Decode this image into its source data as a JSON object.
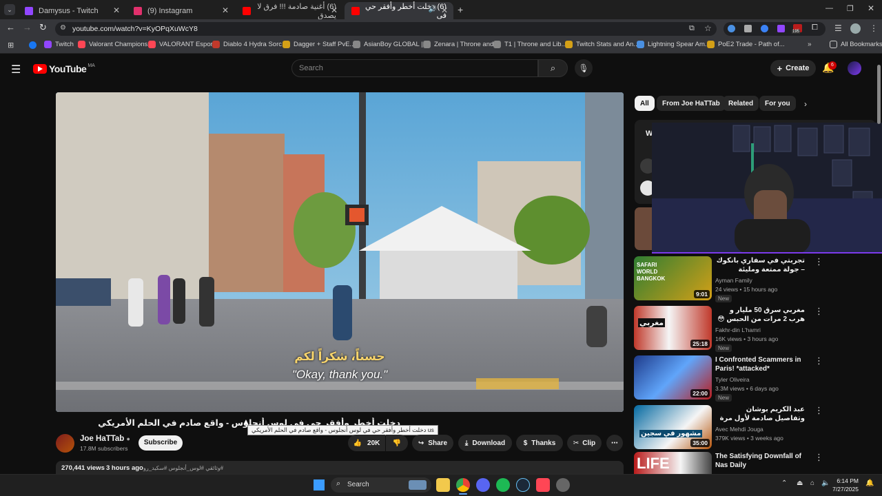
{
  "browser": {
    "tabs": [
      {
        "title": "Damysus - Twitch",
        "color": "#9146ff"
      },
      {
        "title": "(9) Instagram",
        "color": "#e1306c"
      },
      {
        "title": "(6) أغنية صادمة !!! فرق لا يصدق",
        "color": "#ff0000"
      },
      {
        "title": "(6) دخلت أخطر وأفقر حي في",
        "color": "#ff0000"
      }
    ],
    "url": "youtube.com/watch?v=KyOPqXuWcY8",
    "extension_badge": "195",
    "all_bookmarks_label": "All Bookmarks",
    "bookmarks": [
      {
        "label": "Twitch",
        "color": "#9146ff"
      },
      {
        "label": "Valorant Champions...",
        "color": "#ff4655"
      },
      {
        "label": "VALORANT Esports",
        "color": "#ff4655"
      },
      {
        "label": "Diablo 4 Hydra Sorc...",
        "color": "#c0392b"
      },
      {
        "label": "Dagger + Staff PvE...",
        "color": "#d4a017"
      },
      {
        "label": "AsianBoy GLOBAL |...",
        "color": "#888888"
      },
      {
        "label": "Zenara | Throne and...",
        "color": "#888888"
      },
      {
        "label": "T1 | Throne and Lib...",
        "color": "#888888"
      },
      {
        "label": "Twitch Stats and An...",
        "color": "#d4a017"
      },
      {
        "label": "Lightning Spear Am...",
        "color": "#4a90e2"
      },
      {
        "label": "PoE2 Trade - Path of...",
        "color": "#d4a017"
      }
    ]
  },
  "youtube": {
    "logo_text": "YouTube",
    "region": "MA",
    "search_placeholder": "Search",
    "create_label": "Create",
    "notification_count": "6",
    "chips": [
      "All",
      "From Joe HaTTab",
      "Related",
      "For you"
    ],
    "video": {
      "subtitle_arabic": "حسناً، شكراً لكم",
      "subtitle_english": "\"Okay, thank you.\"",
      "title": "دخلت أخطر وأفقر حي في لوس أنجلوس - واقع صادم في الحلم الأمريكي",
      "tooltip": "us دخلت أخطر وأفقر حي في لوس أنجلوس - واقع صادم في الحلم الأمريكي",
      "channel": "Joe HaTTab",
      "subscribers": "17.8M subscribers",
      "subscribe_label": "Subscribe",
      "likes": "20K",
      "share_label": "Share",
      "download_label": "Download",
      "thanks_label": "Thanks",
      "clip_label": "Clip",
      "views": "270,441 views",
      "age": "3 hours ago",
      "hashtags": "#وثائقي #لوس_أنجلوس #سكيد_رو"
    },
    "recommendations": [
      {
        "title": "تجربتي في سفاري بانكوك – جولة ممتعة ومليئة بالمرح 🌿 My Visit to Saf...",
        "channel": "Ayman Family",
        "meta": "24 views • 15 hours ago",
        "badge": "New",
        "duration": "9:01",
        "thumb_text": "SAFARI WORLD BANGKOK"
      },
      {
        "title": "مغربي سرق 50 مليار و هرب 2 مرات من الحبس 😳",
        "channel": "Fakhr-din L'hamri",
        "meta": "16K views • 3 hours ago",
        "badge": "New",
        "duration": "25:18",
        "thumb_text": "مغربي"
      },
      {
        "title": "I Confronted Scammers in Paris! *attacked*",
        "channel": "Tyler Oliveira",
        "meta": "3.3M views • 6 days ago",
        "badge": "New",
        "duration": "22:00",
        "thumb_text": ""
      },
      {
        "title": "عبد الكريم بوشان وتفاصيل صادمة لأول مرة عن علاقته بثورية الذهبي وكيف انتقل من ...",
        "channel": "Avec Mehdi Jouga",
        "meta": "379K views • 3 weeks ago",
        "badge": "",
        "duration": "35:00",
        "thumb_text": "مشهور في سجين"
      },
      {
        "title": "The Satisfying Downfall of Nas Daily",
        "channel": "",
        "meta": "",
        "badge": "",
        "duration": "",
        "thumb_text": "LIFE"
      }
    ],
    "sidebar_card_letter": "W"
  },
  "taskbar": {
    "search_label": "Search",
    "time": "6:14 PM",
    "date": "7/27/2025"
  }
}
